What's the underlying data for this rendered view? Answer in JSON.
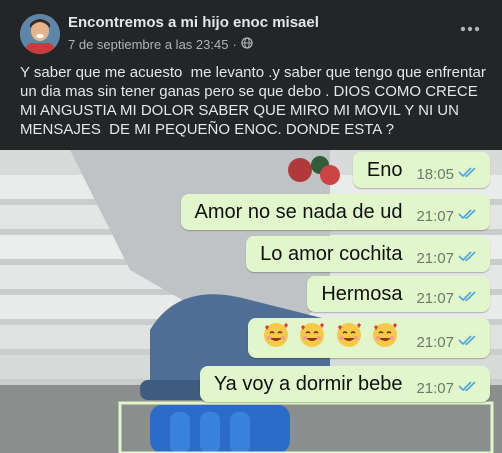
{
  "post": {
    "group_name": "Encontremos a mi hijo enoc misael",
    "date": "7 de septiembre a las 23:45",
    "separator": "·",
    "privacy_icon": "globe-icon",
    "more_icon": "more-dots-icon",
    "text": "Y saber que me acuesto  me levanto .y saber que tengo que enfrentar un dia mas sin tener ganas pero se que debo . DIOS COMO CRECE MI ANGUSTIA MI DOLOR SABER QUE MIRO MI MOVIL Y NI UN MENSAJES  DE MI PEQUEÑO ENOC. DONDE ESTA ?"
  },
  "chat": {
    "bubble_color": "#e1f7cb",
    "tick_color": "#4fa3e0",
    "messages": [
      {
        "text": "Eno",
        "time": "18:05"
      },
      {
        "text": "Amor no se nada de ud",
        "time": "21:07"
      },
      {
        "text": "Lo amor cochita",
        "time": "21:07"
      },
      {
        "text": "Hermosa",
        "time": "21:07"
      },
      {
        "text": "",
        "emoji": "smiling-face-with-hearts-icon",
        "time": "21:07"
      },
      {
        "text": "Ya voy a dormir bebe",
        "time": "21:07"
      }
    ]
  }
}
